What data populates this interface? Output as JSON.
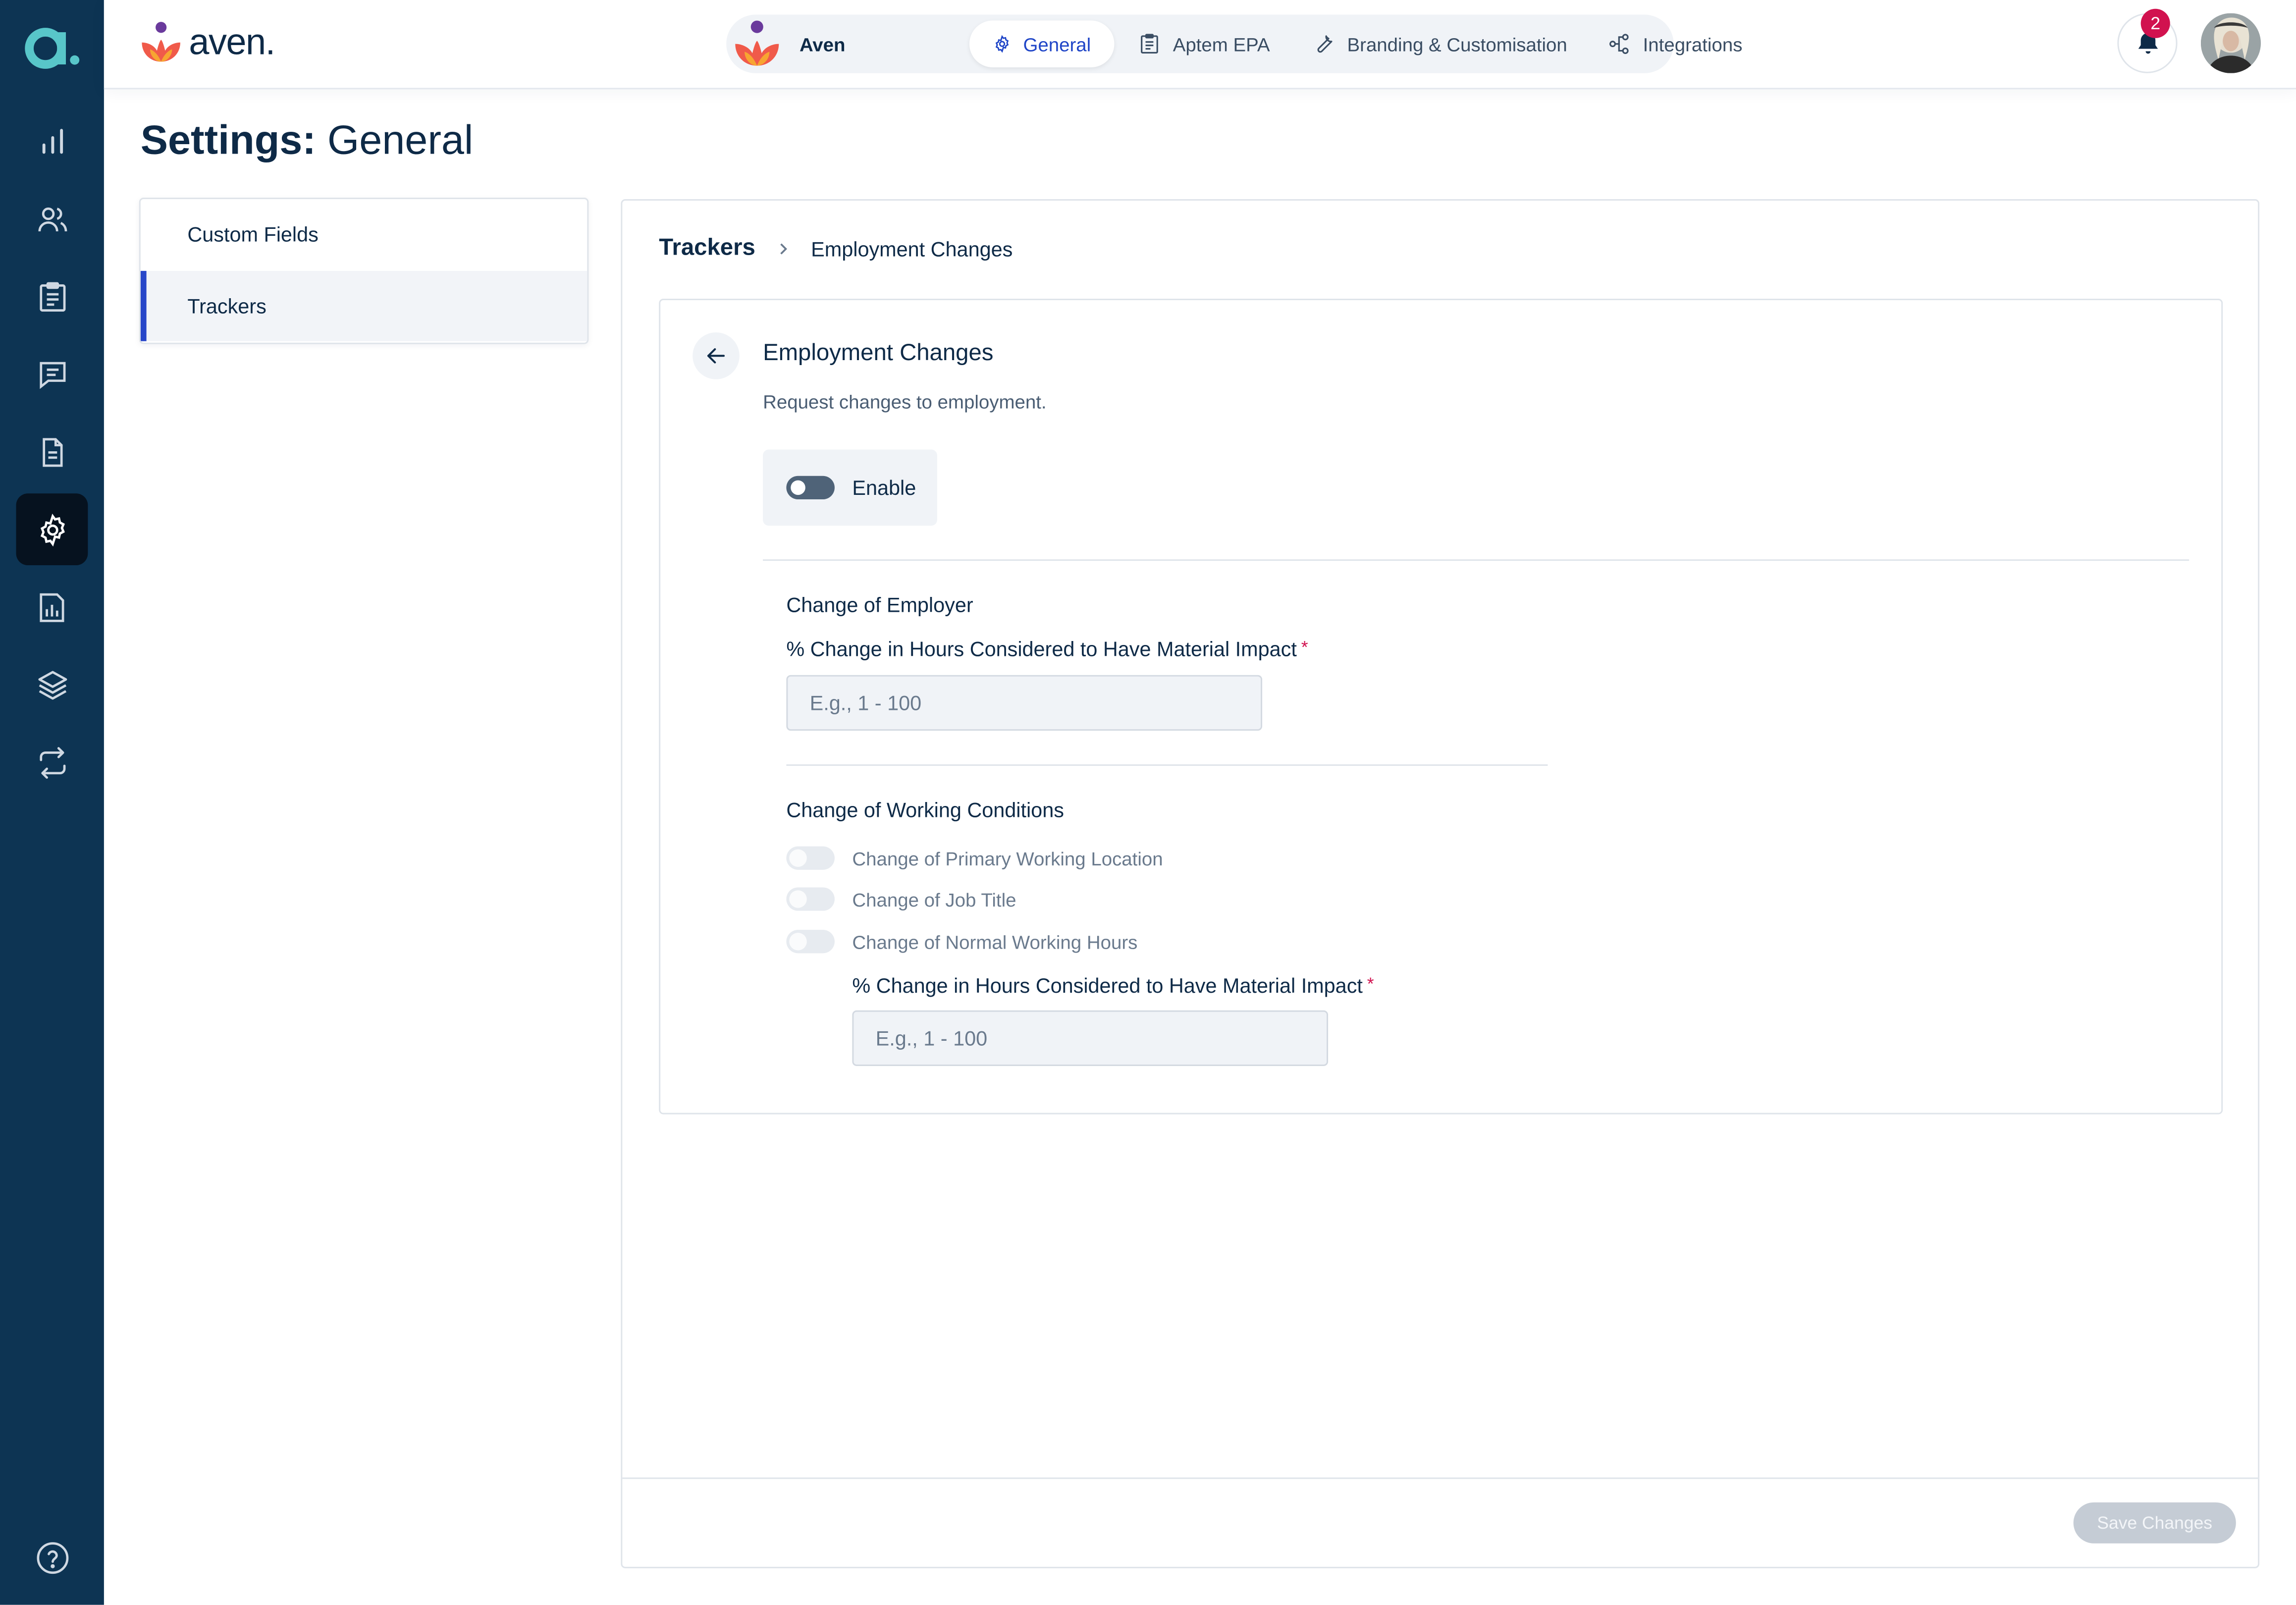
{
  "app": {
    "brand_name": "aven.",
    "side_logo_letter": "a."
  },
  "sidebar": {
    "items": [
      {
        "icon": "bar-chart-icon",
        "active": false
      },
      {
        "icon": "users-icon",
        "active": false
      },
      {
        "icon": "clipboard-icon",
        "active": false
      },
      {
        "icon": "chat-icon",
        "active": false
      },
      {
        "icon": "document-icon",
        "active": false
      },
      {
        "icon": "gear-icon",
        "active": true
      },
      {
        "icon": "report-icon",
        "active": false
      },
      {
        "icon": "layers-icon",
        "active": false
      },
      {
        "icon": "sync-icon",
        "active": false
      }
    ],
    "help_icon": "help-icon"
  },
  "header": {
    "org_label": "Aven",
    "tabs": [
      {
        "label": "General",
        "icon": "gear-icon",
        "active": true
      },
      {
        "label": "Aptem EPA",
        "icon": "clipboard-icon",
        "active": false
      },
      {
        "label": "Branding & Customisation",
        "icon": "wrench-icon",
        "active": false
      },
      {
        "label": "Integrations",
        "icon": "integrations-icon",
        "active": false
      }
    ],
    "notification_count": "2"
  },
  "page": {
    "title_bold": "Settings:",
    "title_rest": "General"
  },
  "subnav": {
    "items": [
      {
        "label": "Custom Fields",
        "active": false
      },
      {
        "label": "Trackers",
        "active": true
      }
    ]
  },
  "breadcrumb": {
    "parent": "Trackers",
    "current": "Employment Changes"
  },
  "tracker": {
    "title": "Employment Changes",
    "description": "Request changes to employment.",
    "enable_label": "Enable",
    "enabled": false,
    "employer_section": {
      "title": "Change of Employer",
      "field_label": "% Change in Hours Considered to Have Material Impact",
      "required_mark": "*",
      "placeholder": "E.g., 1 - 100",
      "value": ""
    },
    "conditions_section": {
      "title": "Change of Working Conditions",
      "options": [
        {
          "label": "Change of Primary Working Location",
          "enabled": false
        },
        {
          "label": "Change of Job Title",
          "enabled": false
        },
        {
          "label": "Change of Normal Working Hours",
          "enabled": false
        }
      ],
      "field_label": "% Change in Hours Considered to Have Material Impact",
      "required_mark": "*",
      "placeholder": "E.g., 1 - 100",
      "value": ""
    }
  },
  "footer": {
    "save_label": "Save Changes"
  },
  "colors": {
    "sidebar_bg": "#0d3453",
    "accent": "#1f45c7",
    "required": "#d1124f",
    "logo_teal": "#58c6c9"
  }
}
